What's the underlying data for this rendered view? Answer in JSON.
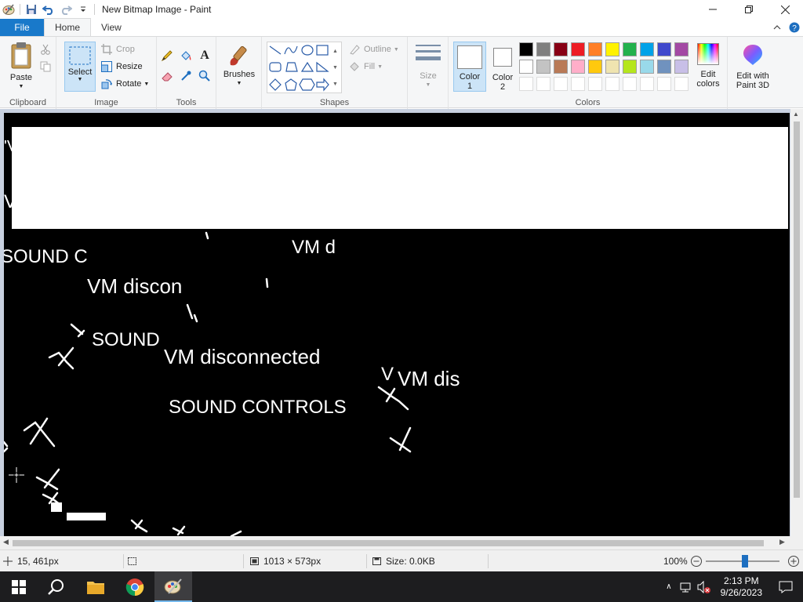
{
  "window": {
    "title": "New Bitmap Image - Paint"
  },
  "tabs": {
    "file": "File",
    "home": "Home",
    "view": "View"
  },
  "ribbon": {
    "clipboard": {
      "paste": "Paste",
      "label": "Clipboard"
    },
    "image": {
      "select": "Select",
      "crop": "Crop",
      "resize": "Resize",
      "rotate": "Rotate",
      "label": "Image"
    },
    "tools": {
      "label": "Tools"
    },
    "brushes": {
      "label": "Brushes"
    },
    "shapes": {
      "outline": "Outline",
      "fill": "Fill",
      "label": "Shapes"
    },
    "size": {
      "label": "Size"
    },
    "color1": {
      "line1": "Color",
      "line2": "1"
    },
    "color2": {
      "line1": "Color",
      "line2": "2"
    },
    "colors": {
      "label": "Colors",
      "row1": [
        "#000000",
        "#7f7f7f",
        "#880015",
        "#ed1c24",
        "#ff7f27",
        "#fff200",
        "#22b14c",
        "#00a2e8",
        "#3f48cc",
        "#a349a4"
      ],
      "row2": [
        "#ffffff",
        "#c3c3c3",
        "#b97a57",
        "#ffaec9",
        "#ffc90e",
        "#efe4b0",
        "#b5e61d",
        "#99d9ea",
        "#7092be",
        "#c8bfe7"
      ]
    },
    "edit_colors": {
      "line1": "Edit",
      "line2": "colors"
    },
    "paint3d": {
      "line1": "Edit with",
      "line2": "Paint 3D"
    }
  },
  "canvas_texts": [
    {
      "text": "'V",
      "size": 20
    },
    {
      "text": "VI",
      "size": 24
    },
    {
      "text": "VM dis",
      "size": 24
    },
    {
      "text": "VM d",
      "size": 24
    },
    {
      "text": "SOUND C",
      "size": 24
    },
    {
      "text": "VM discon",
      "size": 26
    },
    {
      "text": "SOUND",
      "size": 24
    },
    {
      "text": "VM disconnected",
      "size": 26
    },
    {
      "text": "V",
      "size": 24
    },
    {
      "text": "VM dis",
      "size": 26
    },
    {
      "text": "SOUND CONTROLS",
      "size": 24
    }
  ],
  "status": {
    "cursor_pos": "15, 461px",
    "dimensions": "1013 × 573px",
    "size": "Size: 0.0KB",
    "zoom": "100%"
  },
  "taskbar": {
    "time": "2:13 PM",
    "date": "9/26/2023"
  }
}
